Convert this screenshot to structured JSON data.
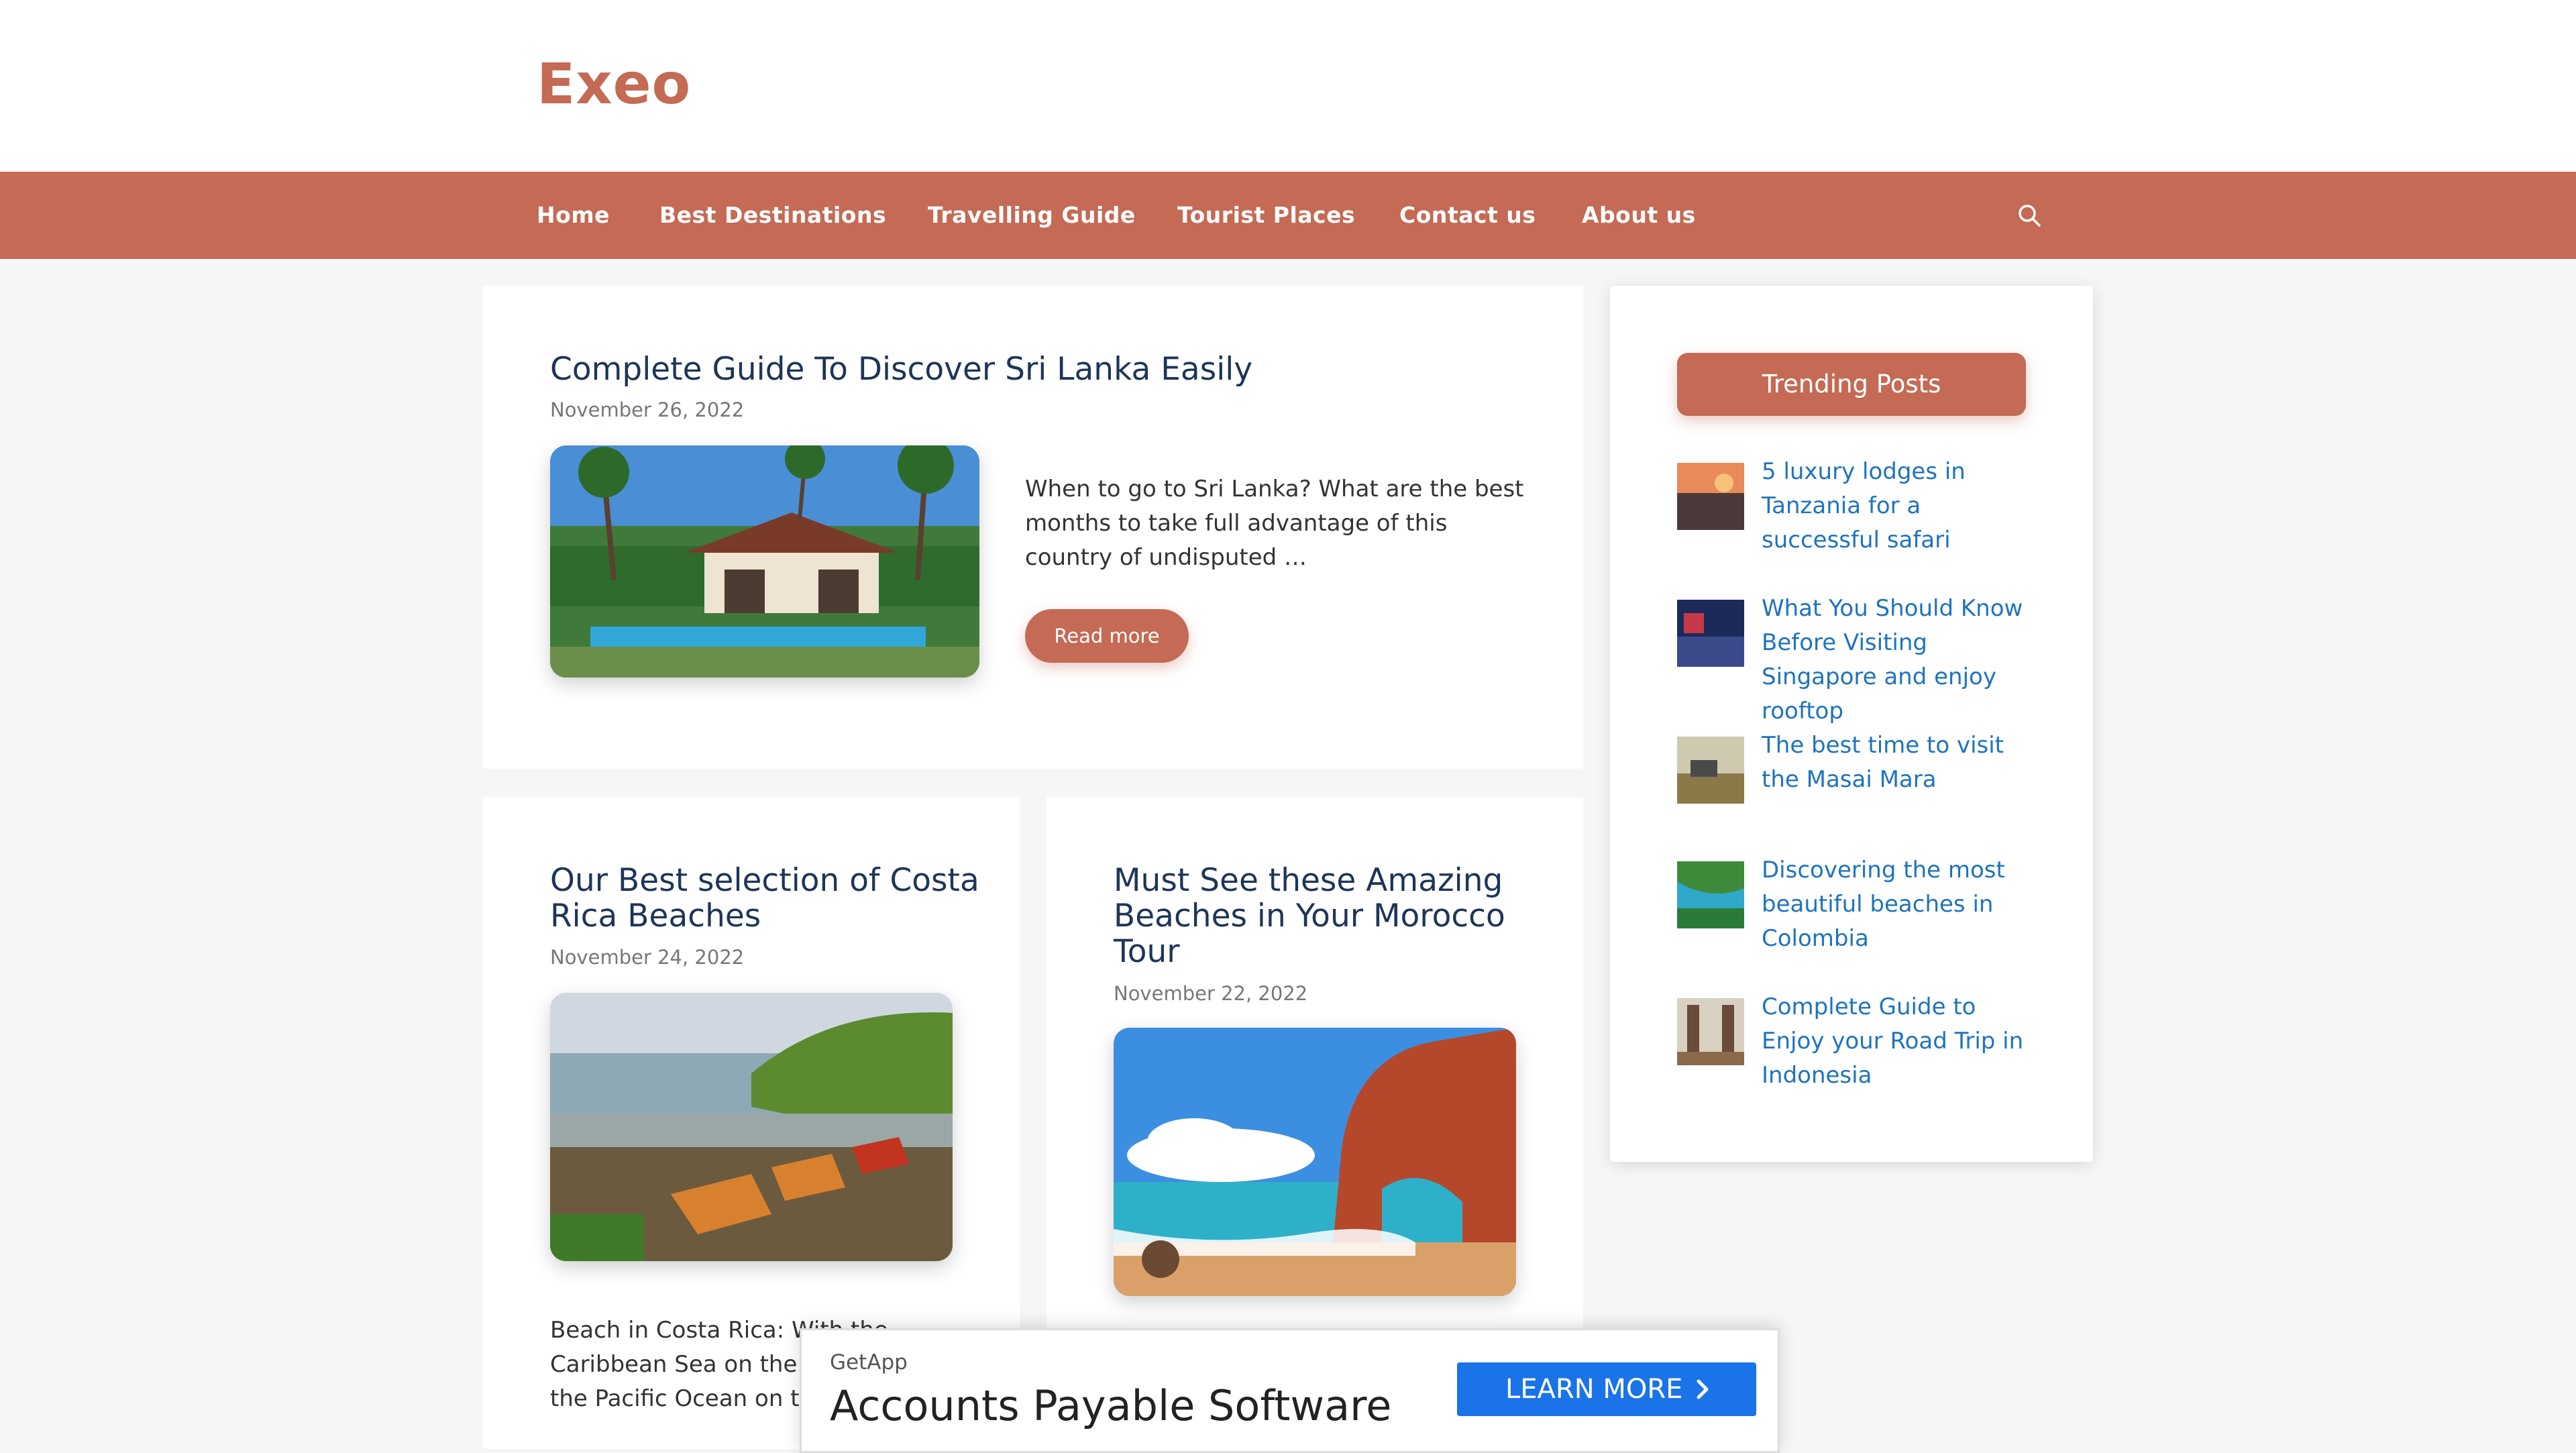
{
  "site": {
    "title": "Exeo"
  },
  "nav": {
    "items": [
      "Home",
      "Best Destinations",
      "Travelling Guide",
      "Tourist Places",
      "Contact us",
      "About us"
    ]
  },
  "featured_post": {
    "title": "Complete Guide To Discover Sri Lanka Easily",
    "date": "November 26, 2022",
    "excerpt": "When to go to Sri Lanka? What are the best months to take full advantage of this country of undisputed …",
    "read_more": "Read more"
  },
  "posts": [
    {
      "title": "Our Best selection of Costa Rica Beaches",
      "date": "November 24, 2022",
      "excerpt": "Beach in Costa Rica: With the Caribbean Sea on the one side and the Pacific Ocean on the other …"
    },
    {
      "title": "Must See these Amazing Beaches in Your Morocco Tour",
      "date": "November 22, 2022"
    }
  ],
  "sidebar": {
    "heading": "Trending Posts",
    "items": [
      "5 luxury lodges in Tanzania for a successful safari",
      "What You Should Know Before Visiting Singapore and enjoy rooftop",
      "The best time to visit the Masai Mara",
      "Discovering the most beautiful beaches in Colombia",
      "Complete Guide to Enjoy your Road Trip in Indonesia"
    ]
  },
  "ad": {
    "brand": "GetApp",
    "headline": "Accounts Payable Software",
    "cta": "LEARN MORE"
  },
  "colors": {
    "accent": "#c46a55",
    "link": "#1e73be",
    "title": "#1d3557"
  },
  "icons": {
    "search": "search-icon",
    "chevron": "chevron-right-icon"
  }
}
